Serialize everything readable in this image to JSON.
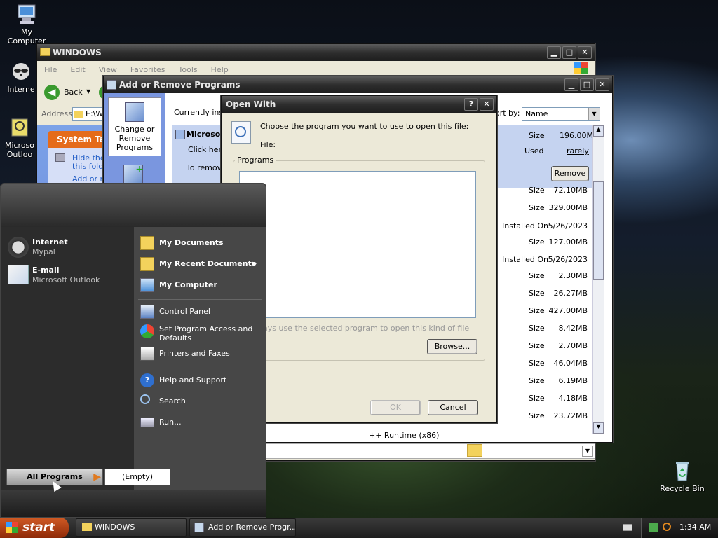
{
  "desktop": {
    "my_computer": "My Computer",
    "internet": "Interne",
    "outlook_line1": "Microso",
    "outlook_line2": "Outloo",
    "recycle_bin": "Recycle Bin"
  },
  "explorer": {
    "title": "WINDOWS",
    "menu": [
      "File",
      "Edit",
      "View",
      "Favorites",
      "Tools",
      "Help"
    ],
    "back_label": "Back",
    "address_label": "Address",
    "address_value": "E:\\W",
    "system_tasks": "System Tas",
    "task_hide_1": "Hide the",
    "task_hide_2": "this folde",
    "task_add": "Add or re"
  },
  "arp": {
    "title": "Add or Remove Programs",
    "change_remove": "Change or Remove Programs",
    "currently_installed": "Currently inst",
    "sort_by_label": "ort by:",
    "sort_by_value": "Name",
    "selected_name": "Microsof",
    "click_here": "Click here",
    "to_remove": "To remov",
    "selected_size_label": "Size",
    "selected_size": "196.00MB",
    "used_label": "Used",
    "used_value": "rarely",
    "remove_button": "Remove",
    "rows": [
      {
        "k": "Size",
        "v": "72.10MB"
      },
      {
        "k": "Size",
        "v": "329.00MB"
      },
      {
        "k": "Installed On",
        "v": "5/26/2023"
      },
      {
        "k": "Size",
        "v": "127.00MB"
      },
      {
        "k": "Installed On",
        "v": "5/26/2023"
      },
      {
        "k": "Size",
        "v": "2.30MB"
      },
      {
        "k": "Size",
        "v": "26.27MB"
      },
      {
        "k": "Size",
        "v": "427.00MB"
      },
      {
        "k": "Size",
        "v": "8.42MB"
      },
      {
        "k": "Size",
        "v": "2.70MB"
      },
      {
        "k": "Size",
        "v": "46.04MB"
      },
      {
        "k": "Size",
        "v": "6.19MB"
      },
      {
        "k": "Size",
        "v": "4.18MB"
      },
      {
        "k": "Size",
        "v": "23.72MB"
      }
    ],
    "bottom_row": "++ Runtime (x86)"
  },
  "open_with": {
    "title": "Open With",
    "help": "?",
    "instruction": "Choose the program you want to use to open this file:",
    "file_label": "File:",
    "programs_label": "Programs",
    "always_use": "ays use the selected program to open this kind of file",
    "browse": "Browse...",
    "ok": "OK",
    "cancel": "Cancel"
  },
  "start_menu": {
    "internet_title": "Internet",
    "internet_sub": "Mypal",
    "email_title": "E-mail",
    "email_sub": "Microsoft Outlook",
    "my_documents": "My Documents",
    "my_recent_documents": "My Recent Documents",
    "my_computer": "My Computer",
    "control_panel": "Control Panel",
    "set_program_access_1": "Set Program Access and",
    "set_program_access_2": "Defaults",
    "printers_and_faxes": "Printers and Faxes",
    "help_and_support": "Help and Support",
    "search": "Search",
    "run": "Run...",
    "all_programs": "All Programs",
    "empty": "(Empty)"
  },
  "taskbar": {
    "start": "start",
    "task1": "WINDOWS",
    "task2": "Add or Remove Progr...",
    "clock": "1:34 AM"
  }
}
